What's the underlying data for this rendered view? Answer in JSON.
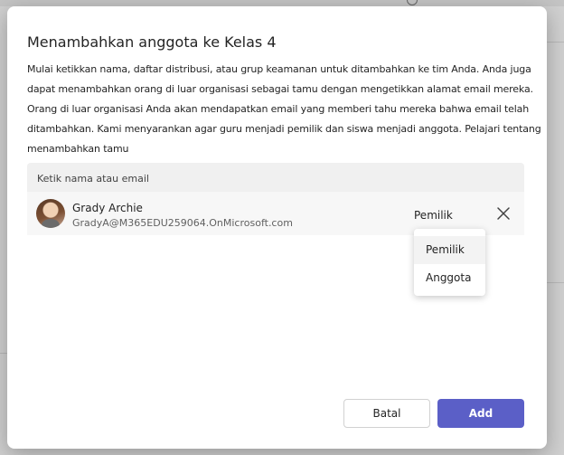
{
  "dialog": {
    "title": "Menambahkan anggota ke Kelas 4",
    "description": "Mulai ketikkan nama, daftar distribusi, atau grup keamanan untuk ditambahkan ke tim Anda. Anda juga dapat menambahkan orang di luar organisasi sebagai tamu dengan mengetikkan alamat email mereka. Orang di luar organisasi Anda akan mendapatkan email yang memberi tahu mereka bahwa email telah ditambahkan. Kami menyarankan agar guru menjadi pemilik dan siswa menjadi anggota.",
    "learn_more_link": "Pelajari tentang menambahkan tamu"
  },
  "search": {
    "placeholder": "Ketik nama atau email"
  },
  "member": {
    "name": "Grady Archie",
    "email": "GradyA@M365EDU259064.OnMicrosoft.com",
    "role": "Pemilik"
  },
  "role_dropdown": {
    "options": [
      "Pemilik",
      "Anggota"
    ],
    "selected": "Pemilik"
  },
  "buttons": {
    "cancel": "Batal",
    "add": "Add"
  },
  "colors": {
    "primary": "#5b5fc7",
    "backdrop": "#d0d0d0"
  },
  "icons": {
    "remove": "close-icon",
    "background_info": "info-icon"
  }
}
